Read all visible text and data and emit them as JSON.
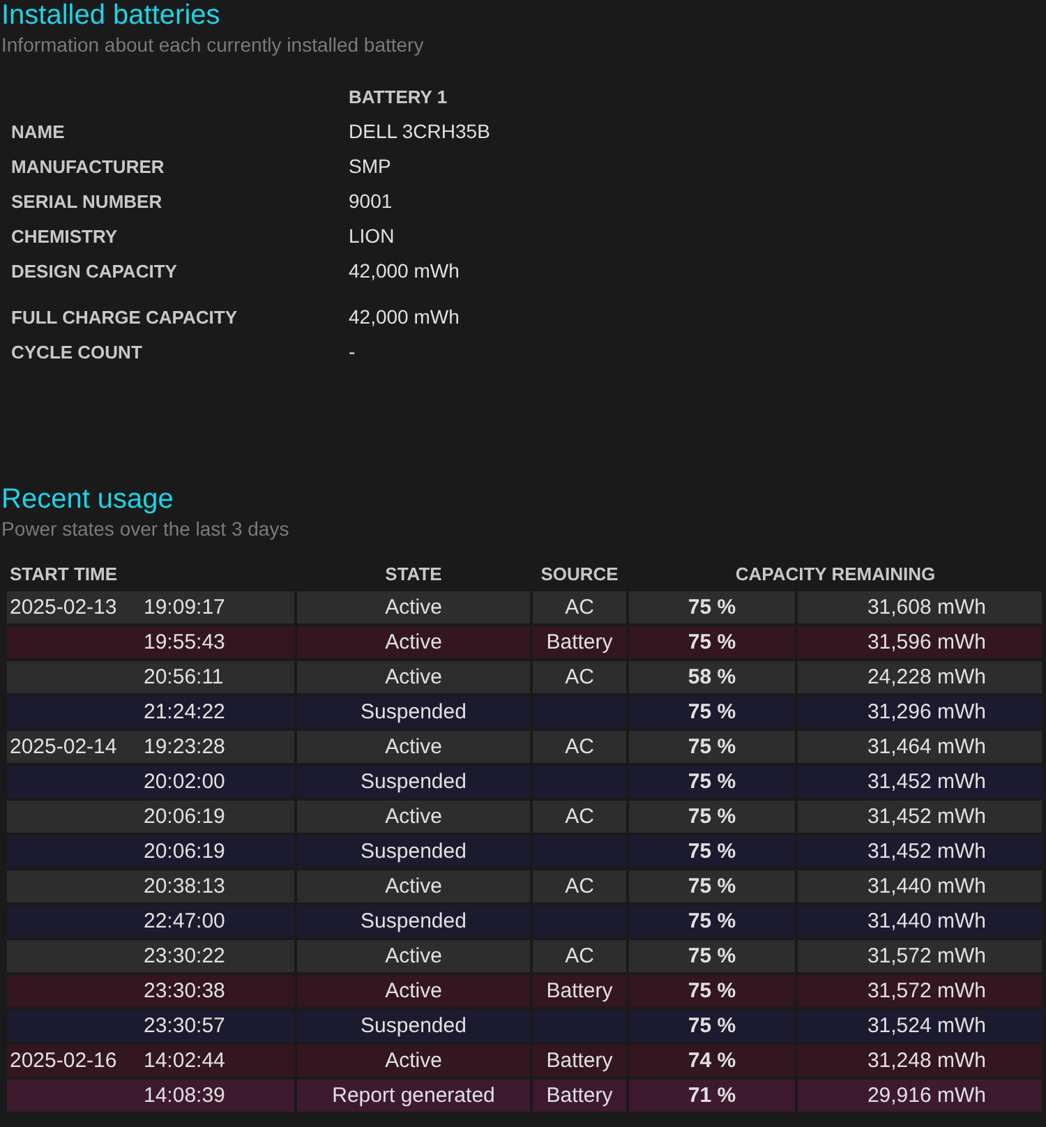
{
  "installed": {
    "title": "Installed batteries",
    "subtitle": "Information about each currently installed battery",
    "column": "BATTERY 1",
    "fields": [
      {
        "label": "NAME",
        "value": "DELL 3CRH35B"
      },
      {
        "label": "MANUFACTURER",
        "value": "SMP"
      },
      {
        "label": "SERIAL NUMBER",
        "value": "9001"
      },
      {
        "label": "CHEMISTRY",
        "value": "LION"
      },
      {
        "label": "DESIGN CAPACITY",
        "value": "42,000 mWh"
      },
      {
        "label": "FULL CHARGE CAPACITY",
        "value": "42,000 mWh"
      },
      {
        "label": "CYCLE COUNT",
        "value": "-"
      }
    ]
  },
  "recent": {
    "title": "Recent usage",
    "subtitle": "Power states over the last 3 days",
    "columns": [
      "START TIME",
      "STATE",
      "SOURCE",
      "CAPACITY REMAINING"
    ],
    "rows": [
      {
        "kind": "ac",
        "date": "2025-02-13",
        "time": "19:09:17",
        "state": "Active",
        "source": "AC",
        "percent": "75 %",
        "capacity": "31,608 mWh"
      },
      {
        "kind": "battery",
        "time": "19:55:43",
        "state": "Active",
        "source": "Battery",
        "percent": "75 %",
        "capacity": "31,596 mWh"
      },
      {
        "kind": "ac",
        "time": "20:56:11",
        "state": "Active",
        "source": "AC",
        "percent": "58 %",
        "capacity": "24,228 mWh"
      },
      {
        "kind": "suspended",
        "time": "21:24:22",
        "state": "Suspended",
        "percent": "75 %",
        "capacity": "31,296 mWh"
      },
      {
        "kind": "ac",
        "date": "2025-02-14",
        "time": "19:23:28",
        "state": "Active",
        "source": "AC",
        "percent": "75 %",
        "capacity": "31,464 mWh"
      },
      {
        "kind": "suspended",
        "time": "20:02:00",
        "state": "Suspended",
        "percent": "75 %",
        "capacity": "31,452 mWh"
      },
      {
        "kind": "ac",
        "time": "20:06:19",
        "state": "Active",
        "source": "AC",
        "percent": "75 %",
        "capacity": "31,452 mWh"
      },
      {
        "kind": "suspended",
        "time": "20:06:19",
        "state": "Suspended",
        "percent": "75 %",
        "capacity": "31,452 mWh"
      },
      {
        "kind": "ac",
        "time": "20:38:13",
        "state": "Active",
        "source": "AC",
        "percent": "75 %",
        "capacity": "31,440 mWh"
      },
      {
        "kind": "suspended",
        "time": "22:47:00",
        "state": "Suspended",
        "percent": "75 %",
        "capacity": "31,440 mWh"
      },
      {
        "kind": "ac",
        "time": "23:30:22",
        "state": "Active",
        "source": "AC",
        "percent": "75 %",
        "capacity": "31,572 mWh"
      },
      {
        "kind": "battery",
        "time": "23:30:38",
        "state": "Active",
        "source": "Battery",
        "percent": "75 %",
        "capacity": "31,572 mWh"
      },
      {
        "kind": "suspended",
        "time": "23:30:57",
        "state": "Suspended",
        "percent": "75 %",
        "capacity": "31,524 mWh"
      },
      {
        "kind": "battery",
        "date": "2025-02-16",
        "time": "14:02:44",
        "state": "Active",
        "source": "Battery",
        "percent": "74 %",
        "capacity": "31,248 mWh"
      },
      {
        "kind": "report",
        "time": "14:08:39",
        "state": "Report generated",
        "source": "Battery",
        "percent": "71 %",
        "capacity": "29,916 mWh"
      }
    ]
  }
}
